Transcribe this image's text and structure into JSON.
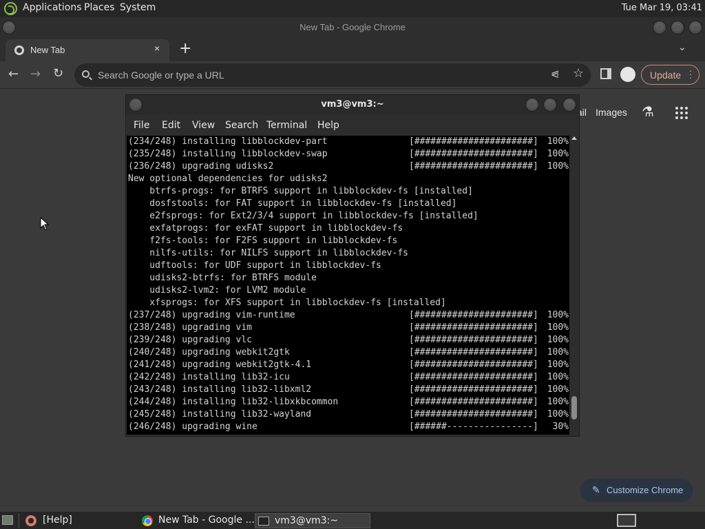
{
  "top_panel": {
    "menus": [
      "Applications",
      "Places",
      "System"
    ],
    "clock": "Tue Mar 19, 03:41"
  },
  "chrome": {
    "window_title": "New Tab - Google Chrome",
    "tab_title": "New Tab",
    "tab_close": "×",
    "new_tab": "+",
    "omnibox_placeholder": "Search Google or type a URL",
    "update_label": "Update",
    "ntp_gmail_partial": "ail",
    "ntp_images": "Images",
    "customize_label": "Customize Chrome"
  },
  "terminal": {
    "title": "vm3@vm3:~",
    "menu": [
      "File",
      "Edit",
      "View",
      "Search",
      "Terminal",
      "Help"
    ],
    "lines": [
      {
        "text": "(234/248) installing libblockdev-part",
        "bar": "[######################]",
        "pct": "100%"
      },
      {
        "text": "(235/248) installing libblockdev-swap",
        "bar": "[######################]",
        "pct": "100%"
      },
      {
        "text": "(236/248) upgrading udisks2",
        "bar": "[######################]",
        "pct": "100%"
      },
      {
        "text": "New optional dependencies for udisks2",
        "bar": "",
        "pct": ""
      },
      {
        "text": "    btrfs-progs: for BTRFS support in libblockdev-fs [installed]",
        "bar": "",
        "pct": ""
      },
      {
        "text": "    dosfstools: for FAT support in libblockdev-fs [installed]",
        "bar": "",
        "pct": ""
      },
      {
        "text": "    e2fsprogs: for Ext2/3/4 support in libblockdev-fs [installed]",
        "bar": "",
        "pct": ""
      },
      {
        "text": "    exfatprogs: for exFAT support in libblockdev-fs",
        "bar": "",
        "pct": ""
      },
      {
        "text": "    f2fs-tools: for F2FS support in libblockdev-fs",
        "bar": "",
        "pct": ""
      },
      {
        "text": "    nilfs-utils: for NILFS support in libblockdev-fs",
        "bar": "",
        "pct": ""
      },
      {
        "text": "    udftools: for UDF support in libblockdev-fs",
        "bar": "",
        "pct": ""
      },
      {
        "text": "    udisks2-btrfs: for BTRFS module",
        "bar": "",
        "pct": ""
      },
      {
        "text": "    udisks2-lvm2: for LVM2 module",
        "bar": "",
        "pct": ""
      },
      {
        "text": "    xfsprogs: for XFS support in libblockdev-fs [installed]",
        "bar": "",
        "pct": ""
      },
      {
        "text": "(237/248) upgrading vim-runtime",
        "bar": "[######################]",
        "pct": "100%"
      },
      {
        "text": "(238/248) upgrading vim",
        "bar": "[######################]",
        "pct": "100%"
      },
      {
        "text": "(239/248) upgrading vlc",
        "bar": "[######################]",
        "pct": "100%"
      },
      {
        "text": "(240/248) upgrading webkit2gtk",
        "bar": "[######################]",
        "pct": "100%"
      },
      {
        "text": "(241/248) upgrading webkit2gtk-4.1",
        "bar": "[######################]",
        "pct": "100%"
      },
      {
        "text": "(242/248) installing lib32-icu",
        "bar": "[######################]",
        "pct": "100%"
      },
      {
        "text": "(243/248) installing lib32-libxml2",
        "bar": "[######################]",
        "pct": "100%"
      },
      {
        "text": "(244/248) installing lib32-libxkbcommon",
        "bar": "[######################]",
        "pct": "100%"
      },
      {
        "text": "(245/248) installing lib32-wayland",
        "bar": "[######################]",
        "pct": "100%"
      },
      {
        "text": "(246/248) upgrading wine",
        "bar": "[######----------------]",
        "pct": " 30%"
      }
    ]
  },
  "taskbar": {
    "tasks": [
      "[Help]",
      "New Tab - Google ...",
      "vm3@vm3:~"
    ]
  },
  "colors": {
    "update_accent": "#e8a798",
    "customize_accent": "#a8c7fa"
  }
}
